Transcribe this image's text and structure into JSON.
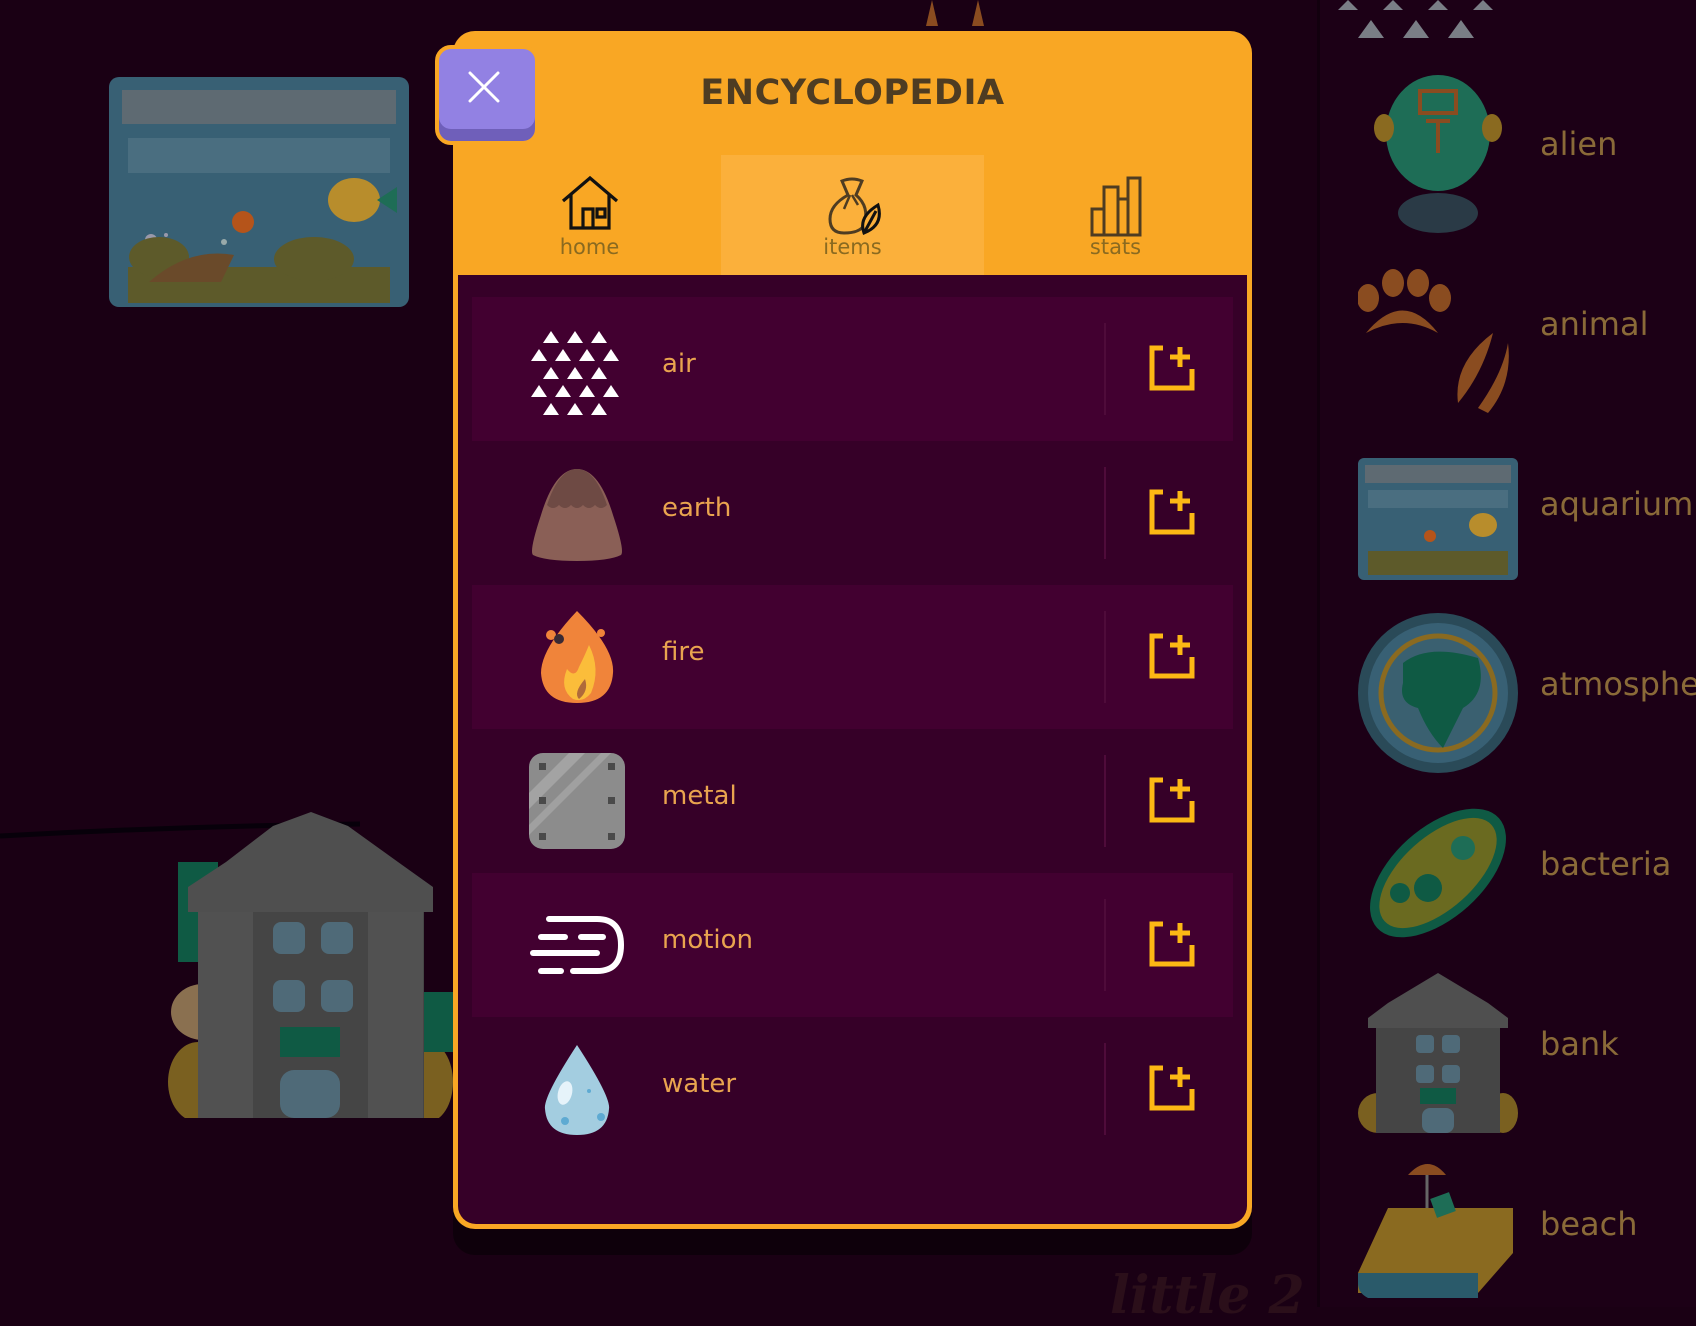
{
  "modal": {
    "title": "ENCYCLOPEDIA",
    "close_icon": "close-icon",
    "tabs": [
      {
        "label": "home",
        "icon": "home-icon",
        "active": false
      },
      {
        "label": "items",
        "icon": "bag-leaf-icon",
        "active": true
      },
      {
        "label": "stats",
        "icon": "bar-chart-icon",
        "active": false
      }
    ],
    "items": [
      {
        "name": "air",
        "icon": "air-icon"
      },
      {
        "name": "earth",
        "icon": "earth-icon"
      },
      {
        "name": "fire",
        "icon": "fire-icon"
      },
      {
        "name": "metal",
        "icon": "metal-icon"
      },
      {
        "name": "motion",
        "icon": "motion-icon"
      },
      {
        "name": "water",
        "icon": "water-icon"
      }
    ],
    "add_icon": "add-to-canvas-icon"
  },
  "sidebar": {
    "items": [
      {
        "name": "alien"
      },
      {
        "name": "animal"
      },
      {
        "name": "aquarium"
      },
      {
        "name": "atmosphere"
      },
      {
        "name": "bacteria"
      },
      {
        "name": "bank"
      },
      {
        "name": "beach"
      }
    ]
  },
  "canvas": {
    "items": [
      {
        "name": "aquarium"
      },
      {
        "name": "bank"
      }
    ],
    "watermark": "little 2"
  },
  "colors": {
    "accent": "#f9a724",
    "background": "#1a0014",
    "panel": "#360028",
    "row_alt": "#420030",
    "item_label": "#e9a44f",
    "close_button": "#9281e3"
  }
}
